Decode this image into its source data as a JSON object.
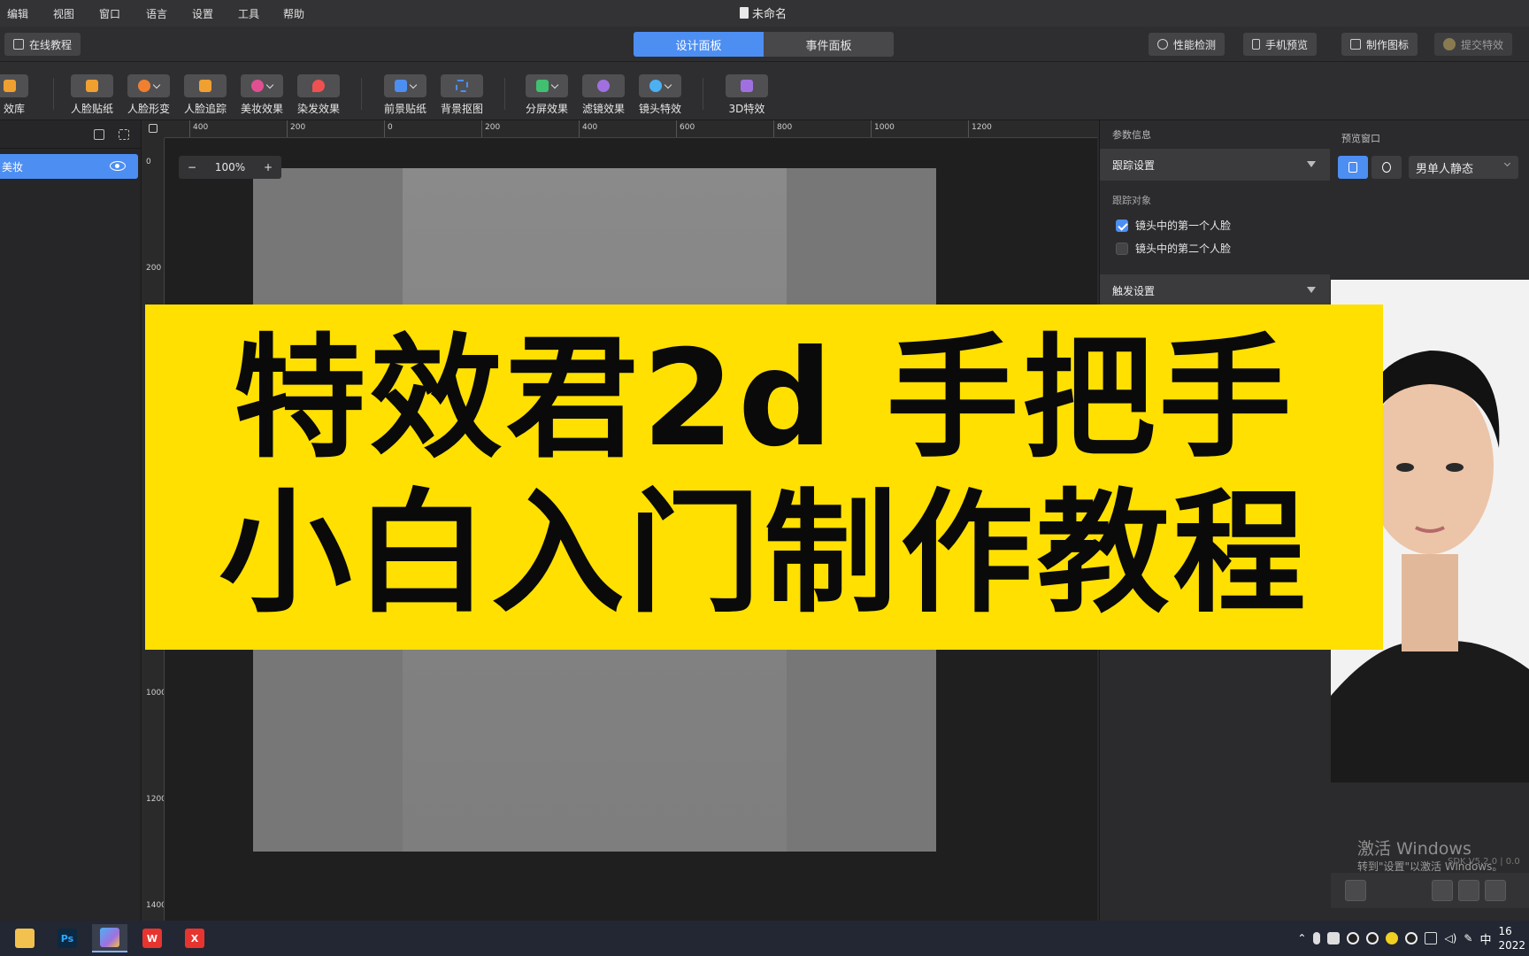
{
  "menu": {
    "items": [
      "编辑",
      "视图",
      "窗口",
      "语言",
      "设置",
      "工具",
      "帮助"
    ],
    "doc_title": "未命名"
  },
  "header": {
    "tutorial_button": "在线教程",
    "tabs": [
      {
        "label": "设计面板",
        "active": true
      },
      {
        "label": "事件面板",
        "active": false
      }
    ],
    "right_buttons": [
      "性能检测",
      "手机预览",
      "制作图标",
      "提交特效"
    ]
  },
  "toolbar": {
    "items": [
      {
        "label": "效库",
        "icon": "library-icon",
        "color": "#f0a030"
      },
      {
        "label": "人脸贴纸",
        "icon": "face-sticker-icon",
        "color": "#f0a030"
      },
      {
        "label": "人脸形变",
        "icon": "face-morph-icon",
        "color": "#f08030"
      },
      {
        "label": "人脸追踪",
        "icon": "face-track-icon",
        "color": "#f0a030"
      },
      {
        "label": "美妆效果",
        "icon": "makeup-icon",
        "color": "#e05090"
      },
      {
        "label": "染发效果",
        "icon": "hair-dye-icon",
        "color": "#f05050"
      },
      {
        "label": "前景贴纸",
        "icon": "foreground-sticker-icon",
        "color": "#4d8ef2"
      },
      {
        "label": "背景抠图",
        "icon": "background-cutout-icon",
        "color": "#4d8ef2"
      },
      {
        "label": "分屏效果",
        "icon": "split-screen-icon",
        "color": "#40c070"
      },
      {
        "label": "滤镜效果",
        "icon": "filter-icon",
        "color": "#a070e0"
      },
      {
        "label": "镜头特效",
        "icon": "lens-effect-icon",
        "color": "#4db0f2"
      },
      {
        "label": "3D特效",
        "icon": "3d-effect-icon",
        "color": "#a070e0"
      }
    ]
  },
  "layers": {
    "items": [
      {
        "label": "美妆",
        "visible": true
      }
    ]
  },
  "canvas": {
    "zoom": "100%",
    "zoom_minus": "−",
    "zoom_plus": "+",
    "ruler_top": [
      "400",
      "200",
      "0",
      "200",
      "400",
      "600",
      "800",
      "1000",
      "1200"
    ],
    "ruler_left": [
      "0",
      "200",
      "1000",
      "1200",
      "1400"
    ]
  },
  "params": {
    "title": "参数信息",
    "tracking_section": "跟踪设置",
    "tracking_target_label": "跟踪对象",
    "options": [
      {
        "label": "镜头中的第一个人脸",
        "checked": true
      },
      {
        "label": "镜头中的第二个人脸",
        "checked": false
      }
    ],
    "trigger_section": "触发设置"
  },
  "preview": {
    "title": "预览窗口",
    "model_select": "男单人静态",
    "activation_title": "激活 Windows",
    "activation_hint": "转到\"设置\"以激活 Windows。",
    "sdk_version": "SDK V5.2.0 | 0.0"
  },
  "banner": {
    "line1": "特效君2d 手把手",
    "line2": "小白入门制作教程",
    "color": "#ffe000"
  },
  "taskbar": {
    "apps": [
      {
        "name": "file-explorer",
        "label": ""
      },
      {
        "name": "photoshop",
        "label": "Ps"
      },
      {
        "name": "effect-editor",
        "label": ""
      },
      {
        "name": "wps",
        "label": "W"
      },
      {
        "name": "xmind",
        "label": "X"
      }
    ],
    "ime": "中",
    "clock_time": "16",
    "clock_date": "2022"
  }
}
